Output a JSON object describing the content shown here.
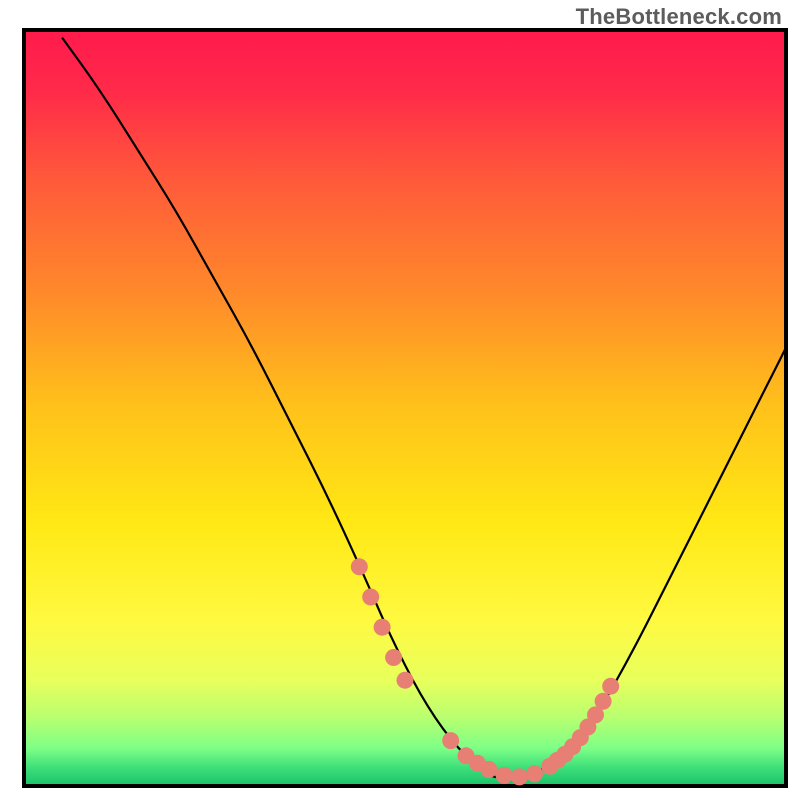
{
  "watermark": "TheBottleneck.com",
  "chart_data": {
    "type": "line",
    "title": "",
    "xlabel": "",
    "ylabel": "",
    "xlim": [
      0,
      100
    ],
    "ylim": [
      0,
      100
    ],
    "background_gradient": {
      "stops": [
        {
          "offset": 0.0,
          "color": "#ff1a4d"
        },
        {
          "offset": 0.08,
          "color": "#ff2a49"
        },
        {
          "offset": 0.2,
          "color": "#ff5a3a"
        },
        {
          "offset": 0.35,
          "color": "#ff8a2a"
        },
        {
          "offset": 0.5,
          "color": "#ffc21a"
        },
        {
          "offset": 0.65,
          "color": "#ffe814"
        },
        {
          "offset": 0.78,
          "color": "#fff940"
        },
        {
          "offset": 0.86,
          "color": "#e8ff5c"
        },
        {
          "offset": 0.91,
          "color": "#b8ff70"
        },
        {
          "offset": 0.95,
          "color": "#7dff86"
        },
        {
          "offset": 0.975,
          "color": "#3fe07a"
        },
        {
          "offset": 1.0,
          "color": "#18c26a"
        }
      ]
    },
    "series": [
      {
        "name": "bottleneck-curve",
        "x": [
          5,
          10,
          15,
          20,
          25,
          30,
          35,
          40,
          45,
          48,
          52,
          56,
          60,
          62,
          65,
          70,
          75,
          80,
          85,
          90,
          95,
          100
        ],
        "values": [
          99,
          92,
          84,
          76,
          67,
          58,
          48,
          38,
          27,
          20,
          12,
          6,
          2,
          1,
          1,
          3,
          9,
          18,
          28,
          38,
          48,
          58
        ]
      }
    ],
    "highlight_points": {
      "name": "curve-markers",
      "color": "#e77f75",
      "x": [
        44,
        45.5,
        47,
        48.5,
        50,
        56,
        58,
        59.5,
        61,
        63,
        65,
        67,
        69,
        70,
        71,
        72,
        73,
        74,
        75,
        76,
        77
      ],
      "values": [
        29,
        25,
        21,
        17,
        14,
        6,
        4,
        3,
        2.2,
        1.4,
        1.2,
        1.6,
        2.6,
        3.4,
        4.2,
        5.2,
        6.4,
        7.8,
        9.4,
        11.2,
        13.2
      ]
    }
  }
}
